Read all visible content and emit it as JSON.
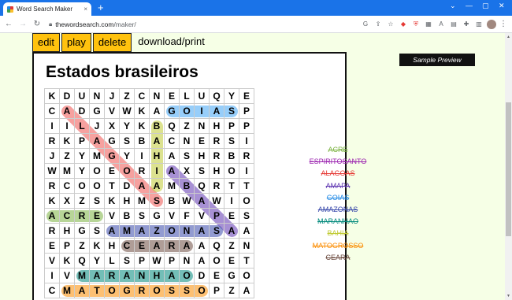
{
  "browser": {
    "tab_title": "Word Search Maker",
    "tab_close": "×",
    "new_tab": "+",
    "url_domain": "thewordsearch.com",
    "url_path": "/maker/",
    "window_controls": [
      "⌄",
      "—",
      "▢",
      "✕"
    ]
  },
  "menu": {
    "edit": "edit",
    "play": "play",
    "delete": "delete",
    "download": "download/print"
  },
  "sample_preview": "Sample Preview",
  "puzzle": {
    "title": "Estados brasileiros",
    "rows": [
      "KDUNJZCNELUQYE",
      "CADGVWKAGOIASP",
      "IILJXYKBQZNHPP",
      "RKPAGSBACNERSI",
      "JZYMGYIHASHRBR",
      "WMYOEORIAXSHOI",
      "RCOOTDAAMBQRTT",
      "KXZSKHMSBWAWIO",
      "ACREVBSGVFVPES",
      "RHGSAMAZONASAA",
      "EPZKHCEARAAQZN",
      "VKQYLSPWPNAOET",
      "IVMARANHAODEGO",
      "CMATOGROSSOPZA"
    ],
    "words": [
      {
        "text": "ACRE",
        "color": "#7cb342"
      },
      {
        "text": "ESPIRITOSANTO",
        "color": "#9c27b0"
      },
      {
        "text": "ALAGOAS",
        "color": "#e53935"
      },
      {
        "text": "AMAPA",
        "color": "#5e35b1"
      },
      {
        "text": "GOIAS",
        "color": "#1e88e5"
      },
      {
        "text": "AMAZONAS",
        "color": "#3949ab"
      },
      {
        "text": "MARANHAO",
        "color": "#00897b"
      },
      {
        "text": "BAHIA",
        "color": "#c0ca33"
      },
      {
        "text": "MATOGROSSO",
        "color": "#fb8c00"
      },
      {
        "text": "CEARA",
        "color": "#6d4c41"
      }
    ],
    "highlights": [
      {
        "word": "GOIAS",
        "color": "#42a5f5",
        "from": [
          1,
          8
        ],
        "to": [
          1,
          12
        ]
      },
      {
        "word": "ESPIRITOSANTO",
        "color": "#ab47bc",
        "from": [
          0,
          14
        ],
        "to": [
          12,
          14
        ]
      },
      {
        "word": "ALAGOAS",
        "color": "#ef5350",
        "from": [
          1,
          1
        ],
        "to": [
          7,
          7
        ]
      },
      {
        "word": "BAHIA",
        "color": "#c0ca33",
        "from": [
          2,
          7
        ],
        "to": [
          6,
          7
        ]
      },
      {
        "word": "AMAPA",
        "color": "#5e35b1",
        "from": [
          5,
          8
        ],
        "to": [
          9,
          12
        ]
      },
      {
        "word": "ACRE",
        "color": "#7cb342",
        "from": [
          8,
          0
        ],
        "to": [
          8,
          3
        ]
      },
      {
        "word": "AMAZONAS",
        "color": "#3949ab",
        "from": [
          9,
          4
        ],
        "to": [
          9,
          11
        ]
      },
      {
        "word": "CEARA",
        "color": "#6d4c41",
        "from": [
          10,
          5
        ],
        "to": [
          10,
          9
        ]
      },
      {
        "word": "MARANHAO",
        "color": "#00897b",
        "from": [
          12,
          2
        ],
        "to": [
          12,
          9
        ]
      },
      {
        "word": "MATOGROSSO",
        "color": "#fb8c00",
        "from": [
          13,
          1
        ],
        "to": [
          13,
          10
        ]
      }
    ]
  }
}
